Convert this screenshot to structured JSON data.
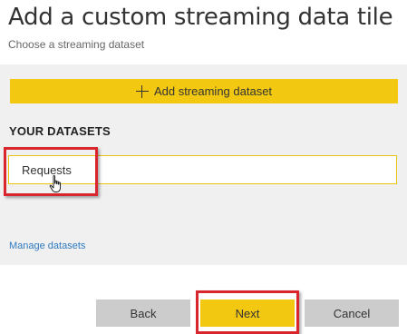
{
  "dialog": {
    "title": "Add a custom streaming data tile",
    "subtitle": "Choose a streaming dataset"
  },
  "panel": {
    "add_button_label": "Add streaming dataset",
    "add_button_icon": "plus-icon",
    "section_heading": "YOUR DATASETS",
    "datasets": [
      {
        "label": "Requests"
      }
    ],
    "manage_link": "Manage datasets"
  },
  "footer": {
    "back_label": "Back",
    "next_label": "Next",
    "cancel_label": "Cancel"
  },
  "colors": {
    "accent": "#f2c811",
    "highlight": "#d9262c",
    "link": "#2f7bc1",
    "button_neutral": "#cccccc",
    "panel_bg": "#f0f0f0"
  }
}
